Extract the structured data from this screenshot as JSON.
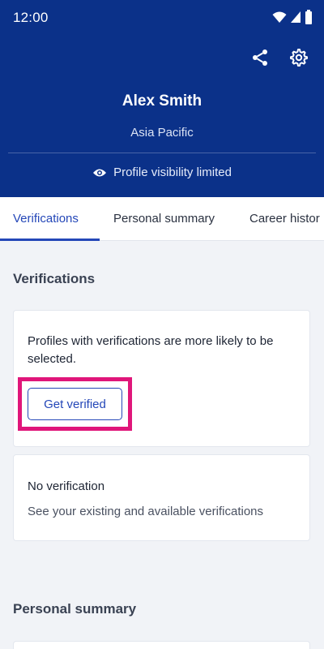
{
  "status_bar": {
    "time": "12:00"
  },
  "header": {
    "name": "Alex Smith",
    "region": "Asia Pacific",
    "visibility": "Profile visibility limited",
    "bg_color": "#0b3189"
  },
  "tabs": [
    {
      "label": "Verifications",
      "active": true
    },
    {
      "label": "Personal summary",
      "active": false
    },
    {
      "label": "Career histor",
      "active": false
    }
  ],
  "verifications": {
    "title": "Verifications",
    "promo_text": "Profiles with verifications are more likely to be selected.",
    "button_label": "Get verified",
    "none_title": "No verification",
    "none_desc": "See your existing and available verifications"
  },
  "personal_summary": {
    "title": "Personal summary"
  },
  "colors": {
    "accent": "#2447b8",
    "highlight": "#e0167a"
  },
  "icons": [
    "wifi-icon",
    "cellular-signal-icon",
    "battery-icon",
    "share-icon",
    "settings-gear-icon",
    "eye-icon"
  ]
}
